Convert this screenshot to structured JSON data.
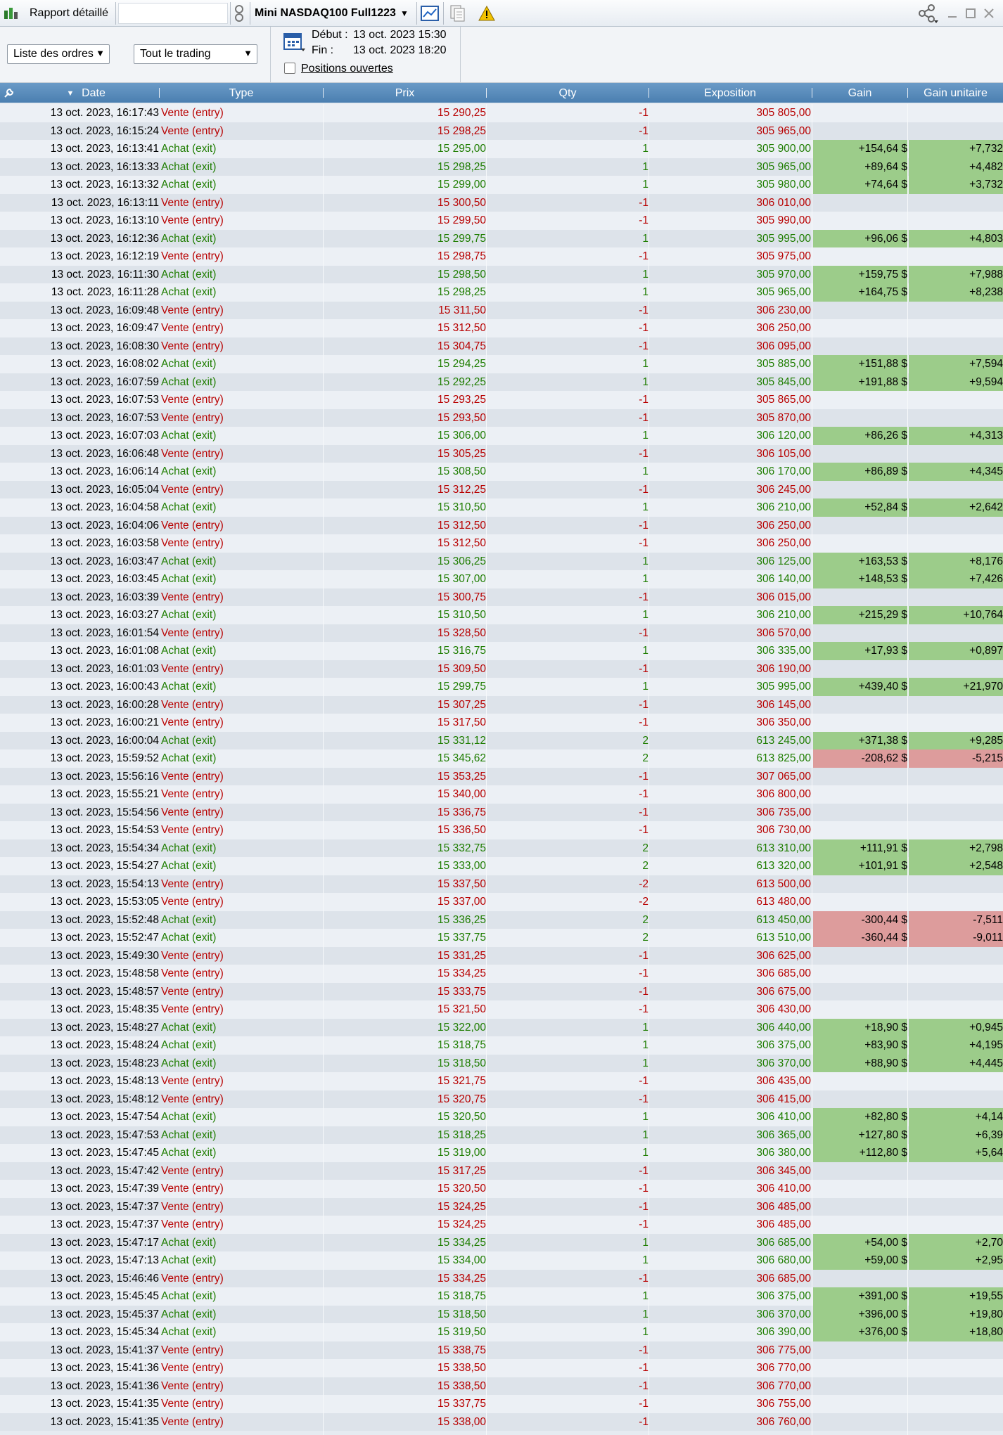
{
  "title_bar": {
    "report_label": "Rapport détaillé",
    "instrument": "Mini NASDAQ100 Full1223"
  },
  "toolbar": {
    "view_select": "Liste des ordres",
    "filter_select": "Tout le trading",
    "start_label": "Début :",
    "start_value": "13 oct. 2023 15:30",
    "end_label": "Fin :",
    "end_value": "13 oct. 2023 18:20",
    "open_positions_label": "Positions ouvertes"
  },
  "columns": {
    "date": "Date",
    "type": "Type",
    "prix": "Prix",
    "qty": "Qty",
    "exposition": "Exposition",
    "gain": "Gain",
    "gain_unitaire": "Gain unitaire"
  },
  "rows": [
    [
      "13 oct. 2023, 16:17:43",
      "Vente (entry)",
      "15 290,25",
      "-1",
      "305 805,00",
      "",
      ""
    ],
    [
      "13 oct. 2023, 16:15:24",
      "Vente (entry)",
      "15 298,25",
      "-1",
      "305 965,00",
      "",
      ""
    ],
    [
      "13 oct. 2023, 16:13:41",
      "Achat (exit)",
      "15 295,00",
      "1",
      "305 900,00",
      "+154,64 $",
      "+7,732"
    ],
    [
      "13 oct. 2023, 16:13:33",
      "Achat (exit)",
      "15 298,25",
      "1",
      "305 965,00",
      "+89,64 $",
      "+4,482"
    ],
    [
      "13 oct. 2023, 16:13:32",
      "Achat (exit)",
      "15 299,00",
      "1",
      "305 980,00",
      "+74,64 $",
      "+3,732"
    ],
    [
      "13 oct. 2023, 16:13:11",
      "Vente (entry)",
      "15 300,50",
      "-1",
      "306 010,00",
      "",
      ""
    ],
    [
      "13 oct. 2023, 16:13:10",
      "Vente (entry)",
      "15 299,50",
      "-1",
      "305 990,00",
      "",
      ""
    ],
    [
      "13 oct. 2023, 16:12:36",
      "Achat (exit)",
      "15 299,75",
      "1",
      "305 995,00",
      "+96,06 $",
      "+4,803"
    ],
    [
      "13 oct. 2023, 16:12:19",
      "Vente (entry)",
      "15 298,75",
      "-1",
      "305 975,00",
      "",
      ""
    ],
    [
      "13 oct. 2023, 16:11:30",
      "Achat (exit)",
      "15 298,50",
      "1",
      "305 970,00",
      "+159,75 $",
      "+7,988"
    ],
    [
      "13 oct. 2023, 16:11:28",
      "Achat (exit)",
      "15 298,25",
      "1",
      "305 965,00",
      "+164,75 $",
      "+8,238"
    ],
    [
      "13 oct. 2023, 16:09:48",
      "Vente (entry)",
      "15 311,50",
      "-1",
      "306 230,00",
      "",
      ""
    ],
    [
      "13 oct. 2023, 16:09:47",
      "Vente (entry)",
      "15 312,50",
      "-1",
      "306 250,00",
      "",
      ""
    ],
    [
      "13 oct. 2023, 16:08:30",
      "Vente (entry)",
      "15 304,75",
      "-1",
      "306 095,00",
      "",
      ""
    ],
    [
      "13 oct. 2023, 16:08:02",
      "Achat (exit)",
      "15 294,25",
      "1",
      "305 885,00",
      "+151,88 $",
      "+7,594"
    ],
    [
      "13 oct. 2023, 16:07:59",
      "Achat (exit)",
      "15 292,25",
      "1",
      "305 845,00",
      "+191,88 $",
      "+9,594"
    ],
    [
      "13 oct. 2023, 16:07:53",
      "Vente (entry)",
      "15 293,25",
      "-1",
      "305 865,00",
      "",
      ""
    ],
    [
      "13 oct. 2023, 16:07:53",
      "Vente (entry)",
      "15 293,50",
      "-1",
      "305 870,00",
      "",
      ""
    ],
    [
      "13 oct. 2023, 16:07:03",
      "Achat (exit)",
      "15 306,00",
      "1",
      "306 120,00",
      "+86,26 $",
      "+4,313"
    ],
    [
      "13 oct. 2023, 16:06:48",
      "Vente (entry)",
      "15 305,25",
      "-1",
      "306 105,00",
      "",
      ""
    ],
    [
      "13 oct. 2023, 16:06:14",
      "Achat (exit)",
      "15 308,50",
      "1",
      "306 170,00",
      "+86,89 $",
      "+4,345"
    ],
    [
      "13 oct. 2023, 16:05:04",
      "Vente (entry)",
      "15 312,25",
      "-1",
      "306 245,00",
      "",
      ""
    ],
    [
      "13 oct. 2023, 16:04:58",
      "Achat (exit)",
      "15 310,50",
      "1",
      "306 210,00",
      "+52,84 $",
      "+2,642"
    ],
    [
      "13 oct. 2023, 16:04:06",
      "Vente (entry)",
      "15 312,50",
      "-1",
      "306 250,00",
      "",
      ""
    ],
    [
      "13 oct. 2023, 16:03:58",
      "Vente (entry)",
      "15 312,50",
      "-1",
      "306 250,00",
      "",
      ""
    ],
    [
      "13 oct. 2023, 16:03:47",
      "Achat (exit)",
      "15 306,25",
      "1",
      "306 125,00",
      "+163,53 $",
      "+8,176"
    ],
    [
      "13 oct. 2023, 16:03:45",
      "Achat (exit)",
      "15 307,00",
      "1",
      "306 140,00",
      "+148,53 $",
      "+7,426"
    ],
    [
      "13 oct. 2023, 16:03:39",
      "Vente (entry)",
      "15 300,75",
      "-1",
      "306 015,00",
      "",
      ""
    ],
    [
      "13 oct. 2023, 16:03:27",
      "Achat (exit)",
      "15 310,50",
      "1",
      "306 210,00",
      "+215,29 $",
      "+10,764"
    ],
    [
      "13 oct. 2023, 16:01:54",
      "Vente (entry)",
      "15 328,50",
      "-1",
      "306 570,00",
      "",
      ""
    ],
    [
      "13 oct. 2023, 16:01:08",
      "Achat (exit)",
      "15 316,75",
      "1",
      "306 335,00",
      "+17,93 $",
      "+0,897"
    ],
    [
      "13 oct. 2023, 16:01:03",
      "Vente (entry)",
      "15 309,50",
      "-1",
      "306 190,00",
      "",
      ""
    ],
    [
      "13 oct. 2023, 16:00:43",
      "Achat (exit)",
      "15 299,75",
      "1",
      "305 995,00",
      "+439,40 $",
      "+21,970"
    ],
    [
      "13 oct. 2023, 16:00:28",
      "Vente (entry)",
      "15 307,25",
      "-1",
      "306 145,00",
      "",
      ""
    ],
    [
      "13 oct. 2023, 16:00:21",
      "Vente (entry)",
      "15 317,50",
      "-1",
      "306 350,00",
      "",
      ""
    ],
    [
      "13 oct. 2023, 16:00:04",
      "Achat (exit)",
      "15 331,12",
      "2",
      "613 245,00",
      "+371,38 $",
      "+9,285"
    ],
    [
      "13 oct. 2023, 15:59:52",
      "Achat (exit)",
      "15 345,62",
      "2",
      "613 825,00",
      "-208,62 $",
      "-5,215"
    ],
    [
      "13 oct. 2023, 15:56:16",
      "Vente (entry)",
      "15 353,25",
      "-1",
      "307 065,00",
      "",
      ""
    ],
    [
      "13 oct. 2023, 15:55:21",
      "Vente (entry)",
      "15 340,00",
      "-1",
      "306 800,00",
      "",
      ""
    ],
    [
      "13 oct. 2023, 15:54:56",
      "Vente (entry)",
      "15 336,75",
      "-1",
      "306 735,00",
      "",
      ""
    ],
    [
      "13 oct. 2023, 15:54:53",
      "Vente (entry)",
      "15 336,50",
      "-1",
      "306 730,00",
      "",
      ""
    ],
    [
      "13 oct. 2023, 15:54:34",
      "Achat (exit)",
      "15 332,75",
      "2",
      "613 310,00",
      "+111,91 $",
      "+2,798"
    ],
    [
      "13 oct. 2023, 15:54:27",
      "Achat (exit)",
      "15 333,00",
      "2",
      "613 320,00",
      "+101,91 $",
      "+2,548"
    ],
    [
      "13 oct. 2023, 15:54:13",
      "Vente (entry)",
      "15 337,50",
      "-2",
      "613 500,00",
      "",
      ""
    ],
    [
      "13 oct. 2023, 15:53:05",
      "Vente (entry)",
      "15 337,00",
      "-2",
      "613 480,00",
      "",
      ""
    ],
    [
      "13 oct. 2023, 15:52:48",
      "Achat (exit)",
      "15 336,25",
      "2",
      "613 450,00",
      "-300,44 $",
      "-7,511"
    ],
    [
      "13 oct. 2023, 15:52:47",
      "Achat (exit)",
      "15 337,75",
      "2",
      "613 510,00",
      "-360,44 $",
      "-9,011"
    ],
    [
      "13 oct. 2023, 15:49:30",
      "Vente (entry)",
      "15 331,25",
      "-1",
      "306 625,00",
      "",
      ""
    ],
    [
      "13 oct. 2023, 15:48:58",
      "Vente (entry)",
      "15 334,25",
      "-1",
      "306 685,00",
      "",
      ""
    ],
    [
      "13 oct. 2023, 15:48:57",
      "Vente (entry)",
      "15 333,75",
      "-1",
      "306 675,00",
      "",
      ""
    ],
    [
      "13 oct. 2023, 15:48:35",
      "Vente (entry)",
      "15 321,50",
      "-1",
      "306 430,00",
      "",
      ""
    ],
    [
      "13 oct. 2023, 15:48:27",
      "Achat (exit)",
      "15 322,00",
      "1",
      "306 440,00",
      "+18,90 $",
      "+0,945"
    ],
    [
      "13 oct. 2023, 15:48:24",
      "Achat (exit)",
      "15 318,75",
      "1",
      "306 375,00",
      "+83,90 $",
      "+4,195"
    ],
    [
      "13 oct. 2023, 15:48:23",
      "Achat (exit)",
      "15 318,50",
      "1",
      "306 370,00",
      "+88,90 $",
      "+4,445"
    ],
    [
      "13 oct. 2023, 15:48:13",
      "Vente (entry)",
      "15 321,75",
      "-1",
      "306 435,00",
      "",
      ""
    ],
    [
      "13 oct. 2023, 15:48:12",
      "Vente (entry)",
      "15 320,75",
      "-1",
      "306 415,00",
      "",
      ""
    ],
    [
      "13 oct. 2023, 15:47:54",
      "Achat (exit)",
      "15 320,50",
      "1",
      "306 410,00",
      "+82,80 $",
      "+4,14"
    ],
    [
      "13 oct. 2023, 15:47:53",
      "Achat (exit)",
      "15 318,25",
      "1",
      "306 365,00",
      "+127,80 $",
      "+6,39"
    ],
    [
      "13 oct. 2023, 15:47:45",
      "Achat (exit)",
      "15 319,00",
      "1",
      "306 380,00",
      "+112,80 $",
      "+5,64"
    ],
    [
      "13 oct. 2023, 15:47:42",
      "Vente (entry)",
      "15 317,25",
      "-1",
      "306 345,00",
      "",
      ""
    ],
    [
      "13 oct. 2023, 15:47:39",
      "Vente (entry)",
      "15 320,50",
      "-1",
      "306 410,00",
      "",
      ""
    ],
    [
      "13 oct. 2023, 15:47:37",
      "Vente (entry)",
      "15 324,25",
      "-1",
      "306 485,00",
      "",
      ""
    ],
    [
      "13 oct. 2023, 15:47:37",
      "Vente (entry)",
      "15 324,25",
      "-1",
      "306 485,00",
      "",
      ""
    ],
    [
      "13 oct. 2023, 15:47:17",
      "Achat (exit)",
      "15 334,25",
      "1",
      "306 685,00",
      "+54,00 $",
      "+2,70"
    ],
    [
      "13 oct. 2023, 15:47:13",
      "Achat (exit)",
      "15 334,00",
      "1",
      "306 680,00",
      "+59,00 $",
      "+2,95"
    ],
    [
      "13 oct. 2023, 15:46:46",
      "Vente (entry)",
      "15 334,25",
      "-1",
      "306 685,00",
      "",
      ""
    ],
    [
      "13 oct. 2023, 15:45:45",
      "Achat (exit)",
      "15 318,75",
      "1",
      "306 375,00",
      "+391,00 $",
      "+19,55"
    ],
    [
      "13 oct. 2023, 15:45:37",
      "Achat (exit)",
      "15 318,50",
      "1",
      "306 370,00",
      "+396,00 $",
      "+19,80"
    ],
    [
      "13 oct. 2023, 15:45:34",
      "Achat (exit)",
      "15 319,50",
      "1",
      "306 390,00",
      "+376,00 $",
      "+18,80"
    ],
    [
      "13 oct. 2023, 15:41:37",
      "Vente (entry)",
      "15 338,75",
      "-1",
      "306 775,00",
      "",
      ""
    ],
    [
      "13 oct. 2023, 15:41:36",
      "Vente (entry)",
      "15 338,50",
      "-1",
      "306 770,00",
      "",
      ""
    ],
    [
      "13 oct. 2023, 15:41:36",
      "Vente (entry)",
      "15 338,50",
      "-1",
      "306 770,00",
      "",
      ""
    ],
    [
      "13 oct. 2023, 15:41:35",
      "Vente (entry)",
      "15 337,75",
      "-1",
      "306 755,00",
      "",
      ""
    ],
    [
      "13 oct. 2023, 15:41:35",
      "Vente (entry)",
      "15 338,00",
      "-1",
      "306 760,00",
      "",
      ""
    ]
  ]
}
